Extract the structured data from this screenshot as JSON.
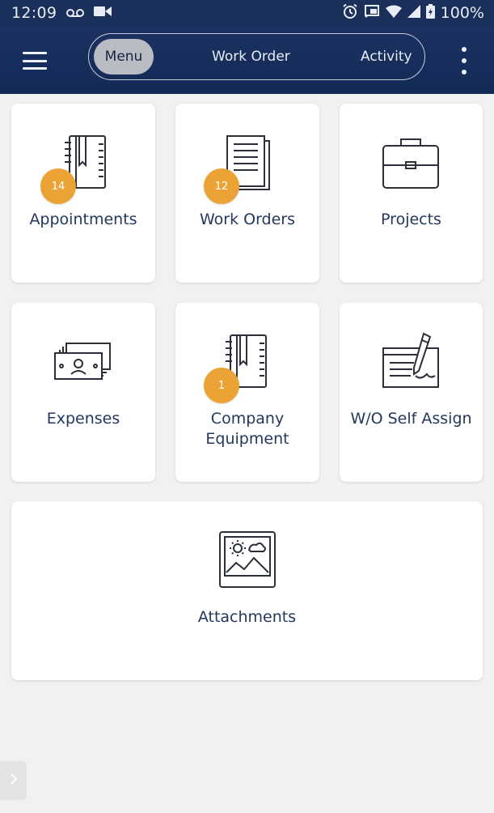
{
  "status_bar": {
    "time": "12:09",
    "battery": "100%",
    "icons": [
      "voicemail-icon",
      "video-icon",
      "alarm-icon",
      "cast-icon",
      "wifi-icon",
      "signal-icon",
      "battery-icon"
    ]
  },
  "header": {
    "tabs": [
      {
        "label": "Menu",
        "active": true
      },
      {
        "label": "Work Order",
        "active": false
      },
      {
        "label": "Activity",
        "active": false
      }
    ]
  },
  "tiles": [
    {
      "label": "Appointments",
      "badge": "14",
      "icon": "planner-icon"
    },
    {
      "label": "Work Orders",
      "badge": "12",
      "icon": "document-icon"
    },
    {
      "label": "Projects",
      "icon": "briefcase-icon"
    },
    {
      "label": "Expenses",
      "icon": "money-icon"
    },
    {
      "label_line1": "Company",
      "label_line2": "Equipment",
      "badge": "1",
      "icon": "planner-icon"
    },
    {
      "label": "W/O Self Assign",
      "icon": "sign-icon"
    },
    {
      "label": "Attachments",
      "icon": "image-icon"
    }
  ],
  "colors": {
    "header_bg": "#1a2f5a",
    "badge": "#eaa334",
    "tile_text": "#24375e",
    "background": "#f1f1f1"
  }
}
